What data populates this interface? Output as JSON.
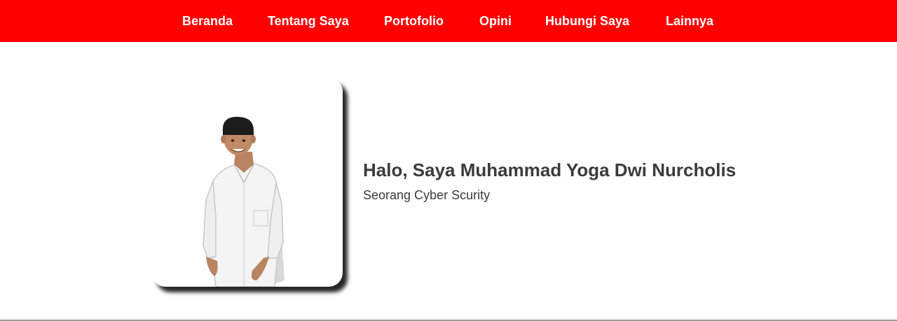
{
  "nav": {
    "items": [
      {
        "label": "Beranda"
      },
      {
        "label": "Tentang Saya"
      },
      {
        "label": "Portofolio"
      },
      {
        "label": "Opini"
      },
      {
        "label": "Hubungi Saya"
      },
      {
        "label": "Lainnya"
      }
    ]
  },
  "hero": {
    "title": "Halo, Saya Muhammad Yoga Dwi Nurcholis",
    "subtitle": "Seorang Cyber Scurity"
  },
  "colors": {
    "nav_background": "#ff0000",
    "nav_text": "#ffffff",
    "heading_text": "#3b3b3b"
  }
}
